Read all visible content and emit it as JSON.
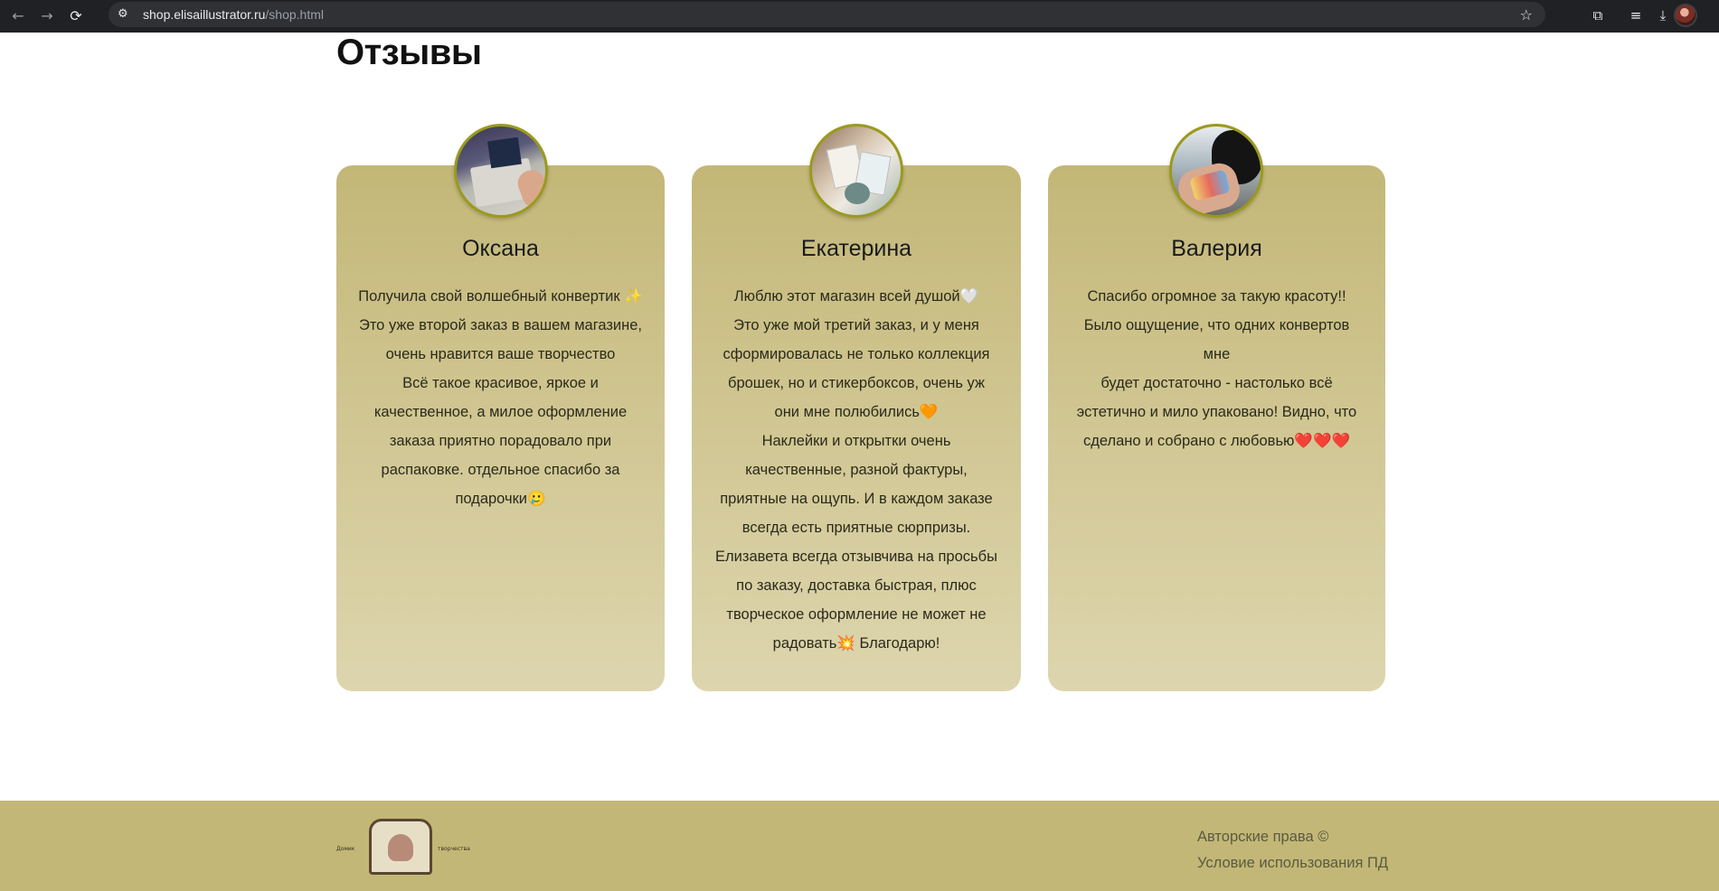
{
  "browser": {
    "url_host": "shop.elisaillustrator.ru",
    "url_path": "/shop.html",
    "back_icon": "←",
    "forward_icon": "→",
    "reload_icon": "⟳",
    "site_settings_icon": "⚙",
    "star_icon": "☆",
    "extensions_icon": "⧉",
    "media_icon": "≡",
    "download_icon": "⤓"
  },
  "section": {
    "title": "Отзывы"
  },
  "reviews": [
    {
      "name": "Оксана",
      "text": "Получила свой волшебный конвертик ✨\nЭто уже второй заказ в вашем магазине,\nочень нравится ваше творчество\nВсё такое красивое, яркое и\nкачественное, а милое оформление\nзаказа приятно порадовало при\nраспаковке. отдельное спасибо за\nподарочки🥲"
    },
    {
      "name": "Екатерина",
      "text": "Люблю этот магазин всей душой🤍\nЭто уже мой третий заказ, и у меня\nсформировалась не только коллекция\nброшек, но и стикербоксов, очень уж\nони мне полюбились🧡\nНаклейки и открытки очень\nкачественные, разной фактуры,\nприятные на ощупь. И в каждом заказе\nвсегда есть приятные сюрпризы.\nЕлизавета всегда отзывчива на просьбы\nпо заказу, доставка быстрая, плюс\nтворческое оформление не может не\nрадовать💥 Благодарю!"
    },
    {
      "name": "Валерия",
      "text": "Спасибо огромное за такую красоту!!\nБыло ощущение, что одних конвертов мне\nбудет достаточно - настолько всё\nэстетично и мило упаковано! Видно, что\nсделано и собрано с любовью❤️❤️❤️"
    }
  ],
  "footer": {
    "logo_left_word": "Домик",
    "logo_right_word": "творчества",
    "copyright": "Авторские права ©",
    "terms": "Условие использования ПД"
  },
  "colors": {
    "card_top": "#c3b777",
    "card_bottom": "#ddd5ae",
    "footer_bg": "#c3b777",
    "avatar_border": "#9a9a1c"
  }
}
